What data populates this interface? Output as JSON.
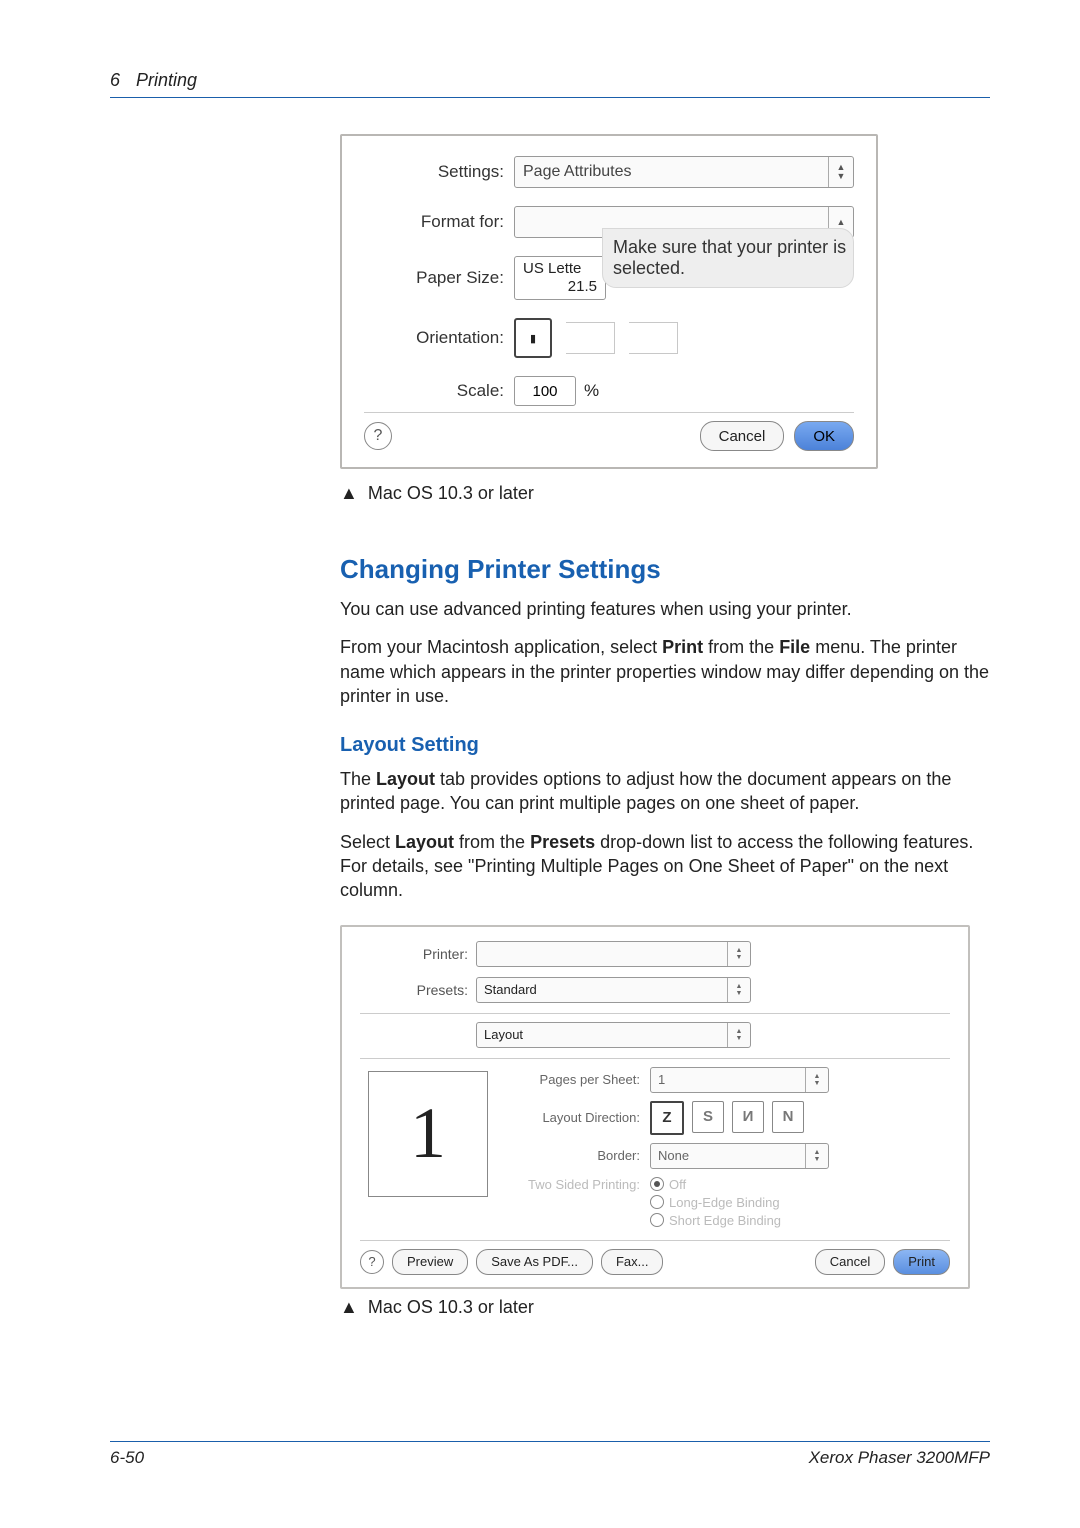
{
  "header": {
    "chapter_num": "6",
    "chapter_title": "Printing"
  },
  "fig1": {
    "settings_label": "Settings:",
    "settings_value": "Page Attributes",
    "format_label": "Format for:",
    "format_value": "",
    "paper_label": "Paper Size:",
    "paper_value": "US Lette",
    "paper_sub": "21.5",
    "orient_label": "Orientation:",
    "scale_label": "Scale:",
    "scale_value": "100",
    "scale_unit": "%",
    "tooltip": "Make sure that your printer is selected.",
    "help": "?",
    "cancel": "Cancel",
    "ok": "OK",
    "caption": "Mac OS 10.3 or later"
  },
  "section": {
    "h2": "Changing Printer Settings",
    "p1": "You can use advanced printing features when using your printer.",
    "p2_a": "From your Macintosh application, select ",
    "p2_b": "Print",
    "p2_c": " from the ",
    "p2_d": "File",
    "p2_e": " menu. The printer name which appears in the printer properties window may differ depending on the printer in use.",
    "h3": "Layout Setting",
    "p3_a": "The ",
    "p3_b": "Layout",
    "p3_c": " tab provides options to adjust how the document appears on the printed page. You can print multiple pages on one sheet of paper.",
    "p4_a": "Select ",
    "p4_b": "Layout",
    "p4_c": " from the ",
    "p4_d": "Presets",
    "p4_e": " drop-down list to access the following features. For details, see \"Printing Multiple Pages on One Sheet of Paper\" on the next column."
  },
  "fig2": {
    "printer_label": "Printer:",
    "printer_value": "",
    "presets_label": "Presets:",
    "presets_value": "Standard",
    "pane_value": "Layout",
    "pps_label": "Pages per Sheet:",
    "pps_value": "1",
    "ldir_label": "Layout Direction:",
    "border_label": "Border:",
    "border_value": "None",
    "tsp_label": "Two Sided Printing:",
    "tsp_off": "Off",
    "tsp_long": "Long-Edge Binding",
    "tsp_short": "Short Edge Binding",
    "thumb": "1",
    "help": "?",
    "preview": "Preview",
    "savepdf": "Save As PDF...",
    "fax": "Fax...",
    "cancel": "Cancel",
    "print": "Print",
    "caption": "Mac OS 10.3 or later"
  },
  "footer": {
    "page": "6-50",
    "product": "Xerox Phaser 3200MFP"
  }
}
